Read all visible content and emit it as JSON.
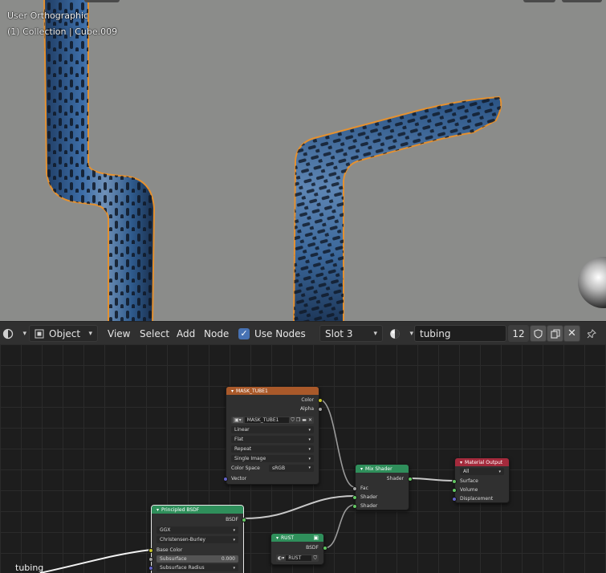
{
  "viewport": {
    "mode_label": "User Orthographic",
    "collection_label": "(1) Collection | Cube.009"
  },
  "header": {
    "editor_icon": "node-editor-icon",
    "object_dropdown": "Object",
    "menus": [
      "View",
      "Select",
      "Add",
      "Node"
    ],
    "use_nodes_label": "Use Nodes",
    "use_nodes_checked": true,
    "slot_dropdown": "Slot 3",
    "material_name": "tubing",
    "user_count": "12",
    "colors": {
      "header_bg": "#303030",
      "accent": "#4772b3"
    }
  },
  "nodes": {
    "mask": {
      "title": "MASK_TUBE1",
      "output_color": "Color",
      "output_alpha": "Alpha",
      "image_name": "MASK_TUBE1",
      "interpolation": "Linear",
      "projection": "Flat",
      "extension": "Repeat",
      "source": "Single Image",
      "color_space_label": "Color Space",
      "color_space_value": "sRGB",
      "input_vector": "Vector",
      "header_color": "#a9592a"
    },
    "mix": {
      "title": "Mix Shader",
      "output": "Shader",
      "input_fac": "Fac",
      "input_shader1": "Shader",
      "input_shader2": "Shader",
      "header_color": "#2f8f5b"
    },
    "output": {
      "title": "Material Output",
      "target": "All",
      "input_surface": "Surface",
      "input_volume": "Volume",
      "input_displacement": "Displacement",
      "header_color": "#a42a3c"
    },
    "principled": {
      "title": "Principled BSDF",
      "output": "BSDF",
      "distribution": "GGX",
      "subsurface_method": "Christensen-Burley",
      "input_base_color": "Base Color",
      "input_subsurface": "Subsurface",
      "subsurface_value": "0.000",
      "input_subsurface_radius": "Subsurface Radius",
      "header_color": "#2f8f5b"
    },
    "rust": {
      "title": "RUST",
      "output": "BSDF",
      "material": "RUST",
      "header_color": "#2f8f5b"
    }
  },
  "frame_label": "tubing"
}
